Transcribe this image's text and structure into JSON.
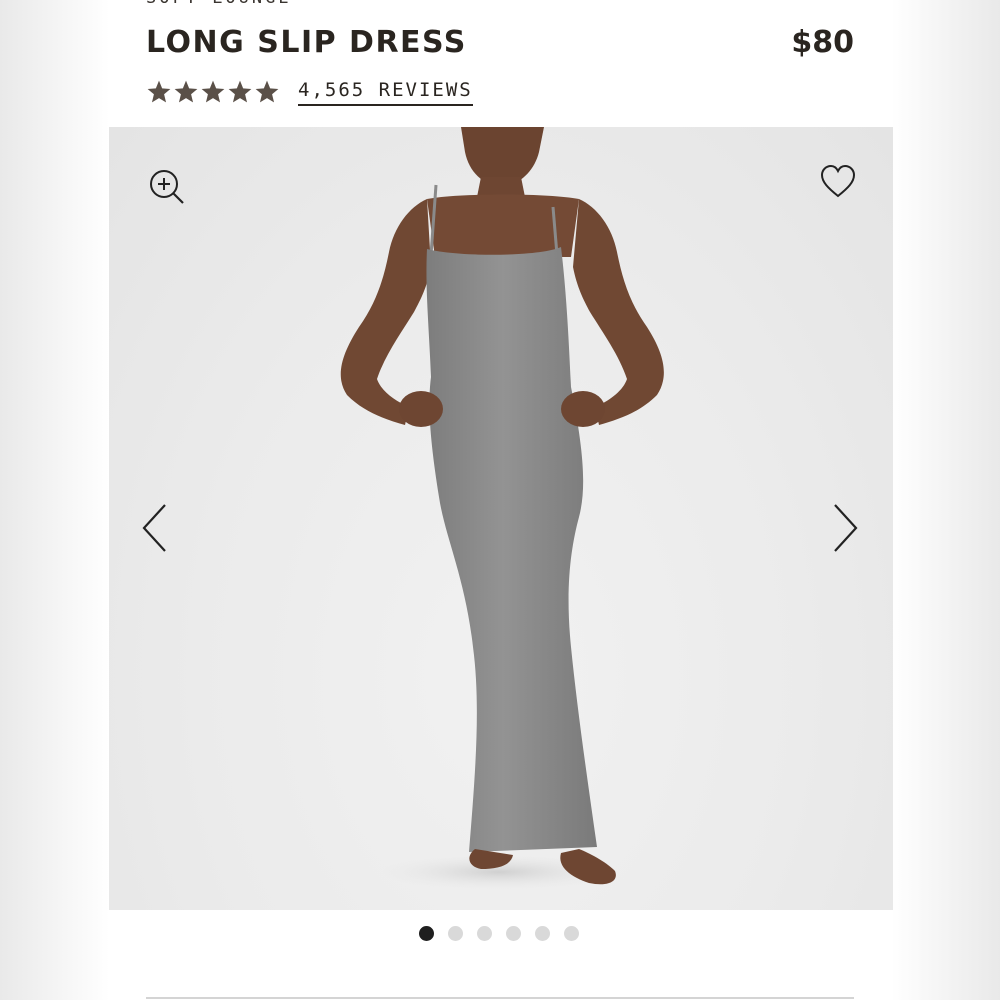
{
  "product": {
    "collection": "SOFT LOUNGE",
    "title": "LONG SLIP DRESS",
    "price": "$80",
    "rating": 5,
    "rating_max": 5,
    "reviews_label": "4,565 REVIEWS"
  },
  "gallery": {
    "icons": {
      "zoom": "zoom-in-icon",
      "favorite": "heart-icon",
      "previous": "chevron-left-icon",
      "next": "chevron-right-icon"
    },
    "image_count": 6,
    "active_index": 0
  },
  "colors": {
    "text": "#2a2520",
    "stars": "#5a5048",
    "dot_active": "#1f1f1f",
    "dot_inactive": "#d9d9d9",
    "dress": "#8a8a8a"
  }
}
